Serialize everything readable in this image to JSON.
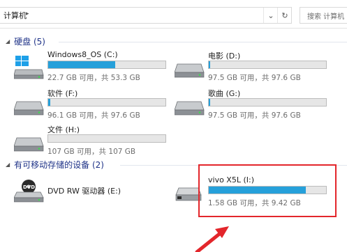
{
  "address": {
    "path": "计算机",
    "search_placeholder": "搜索 计算机"
  },
  "groups": {
    "hard_disks": {
      "label": "硬盘 (5)"
    },
    "removable": {
      "label": "有可移动存储的设备 (2)"
    }
  },
  "drives": [
    {
      "name": "Windows8_OS (C:)",
      "info": "22.7 GB 可用，共 53.3 GB",
      "used_fraction": 0.57
    },
    {
      "name": "电影 (D:)",
      "info": "97.5 GB 可用，共 97.6 GB",
      "used_fraction": 0.01
    },
    {
      "name": "软件 (F:)",
      "info": "96.1 GB 可用，共 97.6 GB",
      "used_fraction": 0.015
    },
    {
      "name": "歌曲 (G:)",
      "info": "97.5 GB 可用，共 97.6 GB",
      "used_fraction": 0.01
    },
    {
      "name": "文件 (H:)",
      "info": "107 GB 可用，共 107 GB",
      "used_fraction": 0.0
    }
  ],
  "removable_devices": [
    {
      "name": "DVD RW 驱动器 (E:)"
    },
    {
      "name": "vivo X5L (I:)",
      "info": "1.58 GB 可用，共 9.42 GB",
      "used_fraction": 0.83
    }
  ],
  "colors": {
    "bar_fill": "#26a0da",
    "group_header": "#1e3287",
    "highlight": "#e3262b"
  },
  "icons": {
    "back": "chevron-right-icon",
    "dropdown": "chevron-down-icon",
    "refresh": "refresh-icon"
  }
}
